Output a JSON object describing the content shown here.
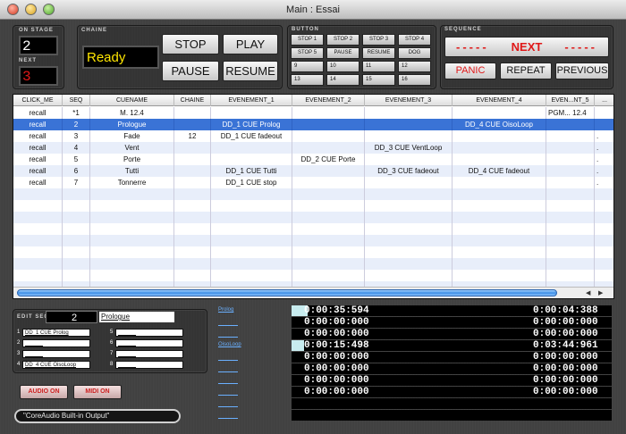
{
  "window": {
    "title": "Main : Essai"
  },
  "on_stage": {
    "label_top": "ON STAGE",
    "value": "2",
    "label_next": "NEXT",
    "next_value": "3"
  },
  "chaine": {
    "title": "CHAINE",
    "status": "Ready"
  },
  "transport": {
    "stop": "STOP",
    "play": "PLAY",
    "pause": "PAUSE",
    "resume": "RESUME"
  },
  "button_panel": {
    "title": "BUTTON",
    "buttons": [
      "STOP 1",
      "STOP 2",
      "STOP 3",
      "STOP 4",
      "STOP 5",
      "PAUSE",
      "RESUME",
      "DOG",
      "9",
      "10",
      "11",
      "12",
      "13",
      "14",
      "15",
      "16"
    ]
  },
  "sequence": {
    "title": "SEQUENCE",
    "next_label": "NEXT",
    "dashes": "-----",
    "panic": "PANIC",
    "repeat": "REPEAT",
    "previous": "PREVIOUS"
  },
  "table": {
    "headers": [
      "CLICK_ME",
      "SEQ",
      "CUENAME",
      "CHAINE",
      "EVENEMENT_1",
      "EVENEMENT_2",
      "EVENEMENT_3",
      "EVENEMENT_4",
      "EVEN...NT_5",
      "..."
    ],
    "rows": [
      [
        "recall",
        "*1",
        "M. 12.4",
        "",
        "",
        "",
        "",
        "",
        "PGM...  12.4",
        ""
      ],
      [
        "recall",
        "2",
        "Prologue",
        "",
        "DD_1 CUE Prolog",
        "",
        "",
        "DD_4 CUE OisoLoop",
        "",
        ""
      ],
      [
        "recall",
        "3",
        "Fade",
        "12",
        "DD_1 CUE fadeout",
        "",
        "",
        "",
        "",
        "."
      ],
      [
        "recall",
        "4",
        "Vent",
        "",
        "",
        "",
        "DD_3 CUE VentLoop",
        "",
        "",
        "."
      ],
      [
        "recall",
        "5",
        "Porte",
        "",
        "",
        "DD_2 CUE Porte",
        "",
        "",
        "",
        "."
      ],
      [
        "recall",
        "6",
        "Tutti",
        "",
        "DD_1 CUE Tutti",
        "",
        "DD_3 CUE fadeout",
        "DD_4 CUE fadeout",
        "",
        "."
      ],
      [
        "recall",
        "7",
        "Tonnerre",
        "",
        "DD_1 CUE stop",
        "",
        "",
        "",
        "",
        "."
      ]
    ],
    "selected_row": 1
  },
  "edit_seq": {
    "title": "EDIT SEQ.",
    "seq_number": "2",
    "cue_name": "Prologue",
    "slots": [
      {
        "n": "1",
        "value": "DD_1 CUE Prolog"
      },
      {
        "n": "2",
        "value": "______"
      },
      {
        "n": "3",
        "value": "______"
      },
      {
        "n": "4",
        "value": "DD_4 CUE OisoLoop"
      },
      {
        "n": "5",
        "value": "______"
      },
      {
        "n": "6",
        "value": "______"
      },
      {
        "n": "7",
        "value": "______"
      },
      {
        "n": "8",
        "value": "______"
      }
    ]
  },
  "audio": {
    "audio_on": "AUDIO ON",
    "midi_on": "MIDI ON",
    "output": "\"CoreAudio Built-in Output\""
  },
  "timers": [
    {
      "link": "Prolog",
      "left": "0:00:35:594",
      "right": "0:00:04:388",
      "progress": 0.05
    },
    {
      "link": "",
      "left": "0:00:00:000",
      "right": "0:00:00:000",
      "progress": 0
    },
    {
      "link": "",
      "left": "0:00:00:000",
      "right": "0:00:00:000",
      "progress": 0
    },
    {
      "link": "OisoLoop",
      "left": "0:00:15:498",
      "right": "0:03:44:961",
      "progress": 0.04
    },
    {
      "link": "",
      "left": "0:00:00:000",
      "right": "0:00:00:000",
      "progress": 0
    },
    {
      "link": "",
      "left": "0:00:00:000",
      "right": "0:00:00:000",
      "progress": 0
    },
    {
      "link": "",
      "left": "0:00:00:000",
      "right": "0:00:00:000",
      "progress": 0
    },
    {
      "link": "",
      "left": "0:00:00:000",
      "right": "0:00:00:000",
      "progress": 0
    },
    {
      "link": "",
      "left": "",
      "right": "",
      "progress": 0
    },
    {
      "link": "",
      "left": "",
      "right": "",
      "progress": 0
    }
  ],
  "colors": {
    "selected_row": "#3a73d6",
    "stripe": "#e8eefa",
    "next_red": "#e01818",
    "lcd_yellow": "#ffe600",
    "led_red": "#cc2020"
  }
}
